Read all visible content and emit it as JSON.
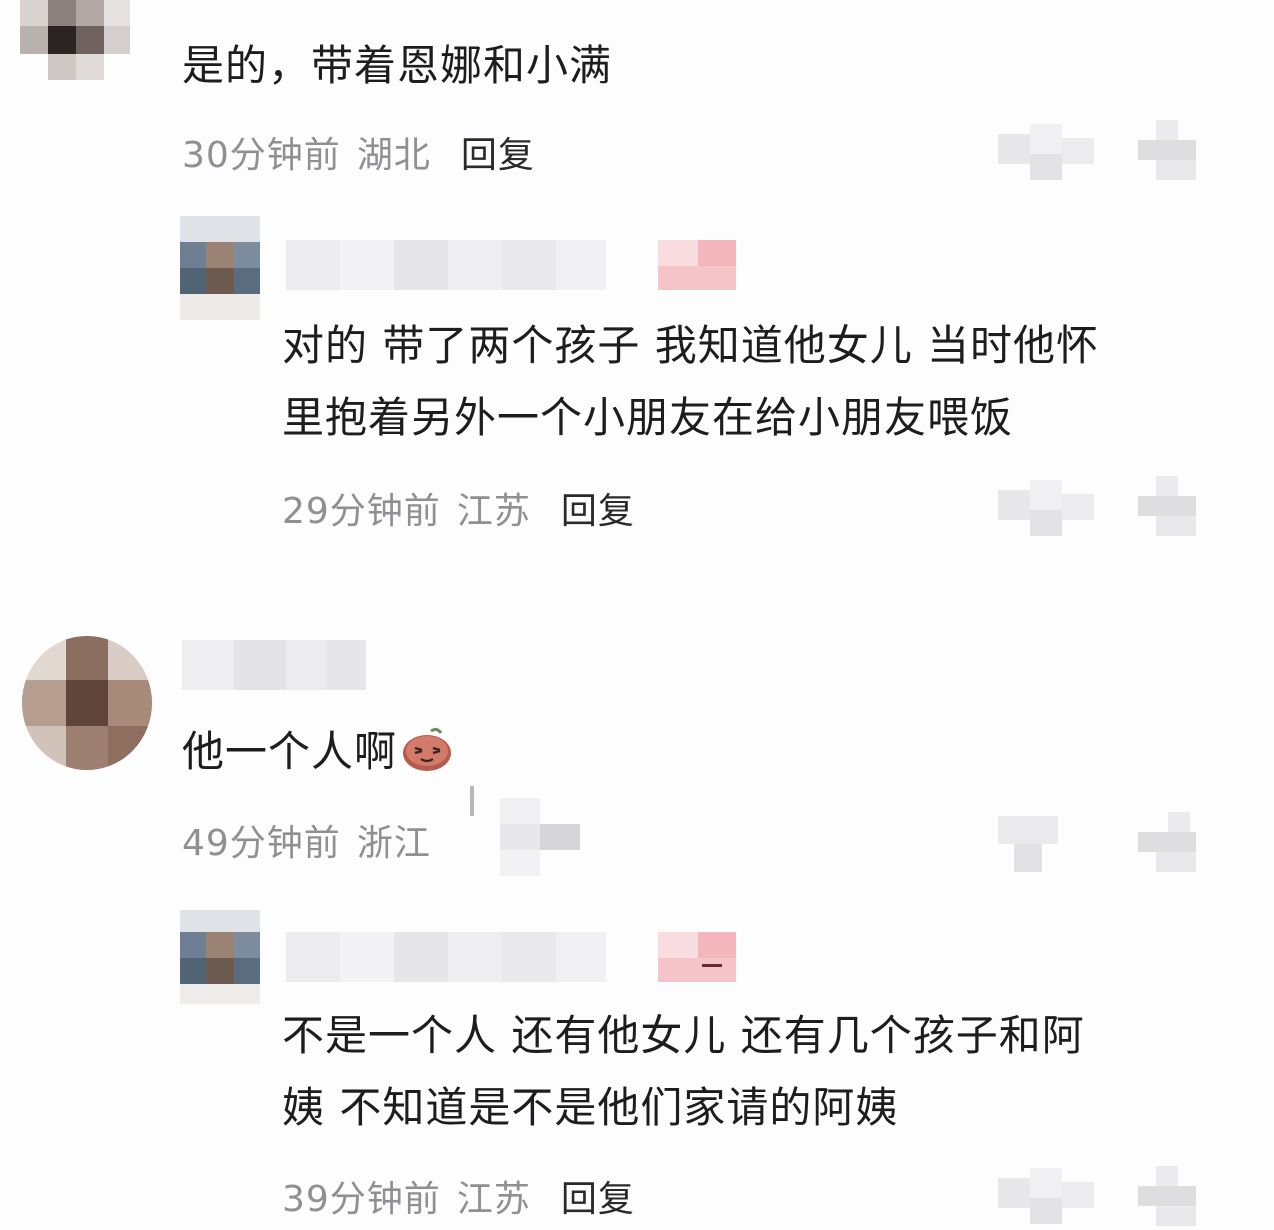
{
  "comments": [
    {
      "text": "是的，带着恩娜和小满",
      "time": "30分钟前",
      "location": "湖北",
      "reply_label": "回复"
    },
    {
      "text_line1": "对的 带了两个孩子 我知道他女儿 当时他怀",
      "text_line2": "里抱着另外一个小朋友在给小朋友喂饭",
      "time": "29分钟前",
      "location": "江苏",
      "reply_label": "回复"
    },
    {
      "text": "他一个人啊",
      "emoji": "smirk-sticker-icon",
      "time": "49分钟前",
      "location": "浙江"
    },
    {
      "text_line1": "不是一个人 还有他女儿 还有几个孩子和阿",
      "text_line2": "姨 不知道是不是他们家请的阿姨",
      "time": "39分钟前",
      "location": "江苏",
      "reply_label": "回复"
    }
  ],
  "colors": {
    "text": "#1d1d1f",
    "meta": "#8f8f94",
    "badge_pink": "#f2b6bc"
  }
}
